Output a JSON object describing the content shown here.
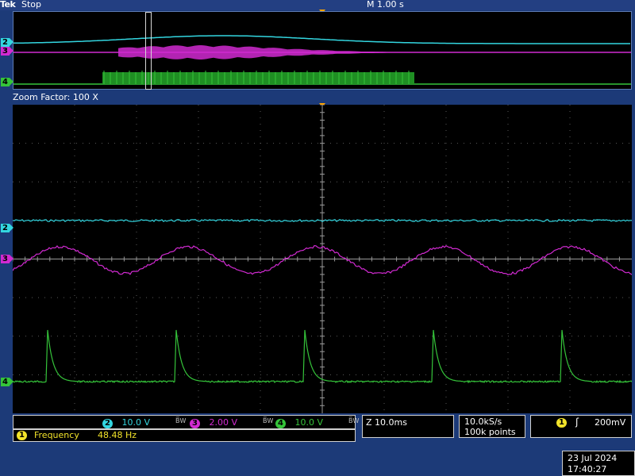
{
  "status": {
    "brand": "Tek",
    "run_state": "Stop",
    "timebase": "M 1.00 s"
  },
  "zoom": {
    "factor_label": "Zoom Factor: 100 X"
  },
  "channels": [
    {
      "num": "2",
      "scale": "10.0 V",
      "color": "#33d6e0"
    },
    {
      "num": "3",
      "scale": "2.00 V",
      "color": "#d12ad1"
    },
    {
      "num": "4",
      "scale": "10.0 V",
      "color": "#35c43a"
    }
  ],
  "bandwidth_symbol": "B̅W",
  "measurement": {
    "channel": "1",
    "label": "Frequency",
    "value": "48.48 Hz"
  },
  "zoom_timebase": "Z 10.0ms",
  "acquisition": {
    "rate": "10.0kS/s",
    "points": "100k points"
  },
  "trigger": {
    "channel": "1",
    "slope_symbol": "ʃ",
    "level": "200mV"
  },
  "datetime": {
    "date": "23 Jul  2024",
    "time": "17:40:27"
  },
  "colors": {
    "ch1": "#f2e32a",
    "ch2": "#33d6e0",
    "ch3": "#d12ad1",
    "ch4": "#35c43a",
    "trigger_marker": "#ffa500"
  },
  "waveforms": {
    "sine_cycles_in_zoom": 4.85,
    "frequency_hz": 48.48
  }
}
